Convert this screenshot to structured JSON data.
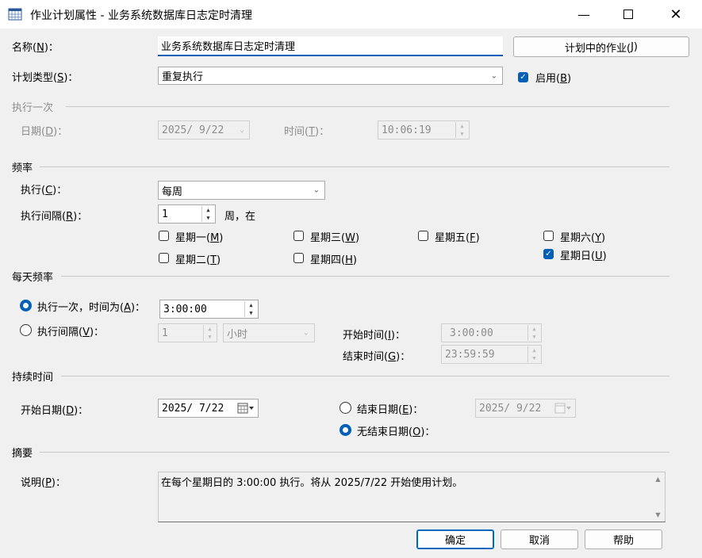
{
  "window": {
    "title": "作业计划属性 - 业务系统数据库日志定时清理"
  },
  "name": {
    "label": "名称(",
    "accel": "N",
    "suffix": ")：",
    "value": "业务系统数据库日志定时清理"
  },
  "jobs_button": {
    "label": "计划中的作业(",
    "accel": "J",
    "suffix": ")"
  },
  "schedule_type": {
    "label": "计划类型(",
    "accel": "S",
    "suffix": ")：",
    "value": "重复执行"
  },
  "enabled": {
    "label": "启用(",
    "accel": "B",
    "suffix": ")",
    "checked": true
  },
  "once_section": {
    "title": "执行一次",
    "date_label": "日期(",
    "date_accel": "D",
    "date_suffix": ")：",
    "date_value": "2025/ 9/22",
    "time_label": "时间(",
    "time_accel": "T",
    "time_suffix": ")：",
    "time_value": "10:06:19"
  },
  "frequency": {
    "title": "频率",
    "occurs_label": "执行(",
    "occurs_accel": "C",
    "occurs_suffix": ")：",
    "occurs_value": "每周",
    "recurs_label": "执行间隔(",
    "recurs_accel": "R",
    "recurs_suffix": ")：",
    "recurs_value": "1",
    "recurs_unit": "周，在",
    "days": [
      {
        "label": "星期一(",
        "accel": "M",
        "suffix": ")",
        "checked": false
      },
      {
        "label": "星期三(",
        "accel": "W",
        "suffix": ")",
        "checked": false
      },
      {
        "label": "星期五(",
        "accel": "F",
        "suffix": ")",
        "checked": false
      },
      {
        "label": "星期六(",
        "accel": "Y",
        "suffix": ")",
        "checked": false
      },
      {
        "label": "星期二(",
        "accel": "T",
        "suffix": ")",
        "checked": false
      },
      {
        "label": "星期四(",
        "accel": "H",
        "suffix": ")",
        "checked": false
      },
      {
        "label": "星期日(",
        "accel": "U",
        "suffix": ")",
        "checked": true
      }
    ]
  },
  "daily": {
    "title": "每天频率",
    "once_label": "执行一次，时间为(",
    "once_accel": "A",
    "once_suffix": ")：",
    "once_value": "3:00:00",
    "once_selected": true,
    "every_label": "执行间隔(",
    "every_accel": "V",
    "every_suffix": ")：",
    "every_value": "1",
    "every_unit": "小时",
    "start_label": "开始时间(",
    "start_accel": "I",
    "start_suffix": ")：",
    "start_value": "3:00:00",
    "end_label": "结束时间(",
    "end_accel": "G",
    "end_suffix": ")：",
    "end_value": "23:59:59"
  },
  "duration": {
    "title": "持续时间",
    "start_label": "开始日期(",
    "start_accel": "D",
    "start_suffix": ")：",
    "start_value": "2025/ 7/22",
    "end_label": "结束日期(",
    "end_accel": "E",
    "end_suffix": ")：",
    "end_value": "2025/ 9/22",
    "noend_label": "无结束日期(",
    "noend_accel": "O",
    "noend_suffix": ")：",
    "noend_selected": true
  },
  "summary": {
    "title": "摘要",
    "desc_label": "说明(",
    "desc_accel": "P",
    "desc_suffix": ")：",
    "desc_value": "在每个星期日的 3:00:00 执行。将从 2025/7/22 开始使用计划。"
  },
  "buttons": {
    "ok": "确定",
    "cancel": "取消",
    "help": "帮助"
  },
  "colors": {
    "accent": "#005fb8",
    "background": "#f0f0f0"
  }
}
